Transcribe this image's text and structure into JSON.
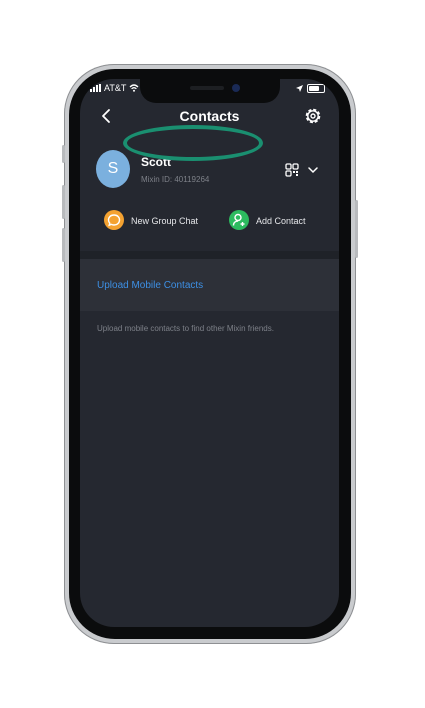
{
  "status_bar": {
    "carrier": "AT&T"
  },
  "nav": {
    "title": "Contacts",
    "back_icon": "chevron-left-icon",
    "settings_icon": "gear-icon"
  },
  "profile": {
    "avatar_initial": "S",
    "name": "Scott",
    "mixin_id": "Mixin ID: 40119264",
    "qr_icon": "qr-code-icon",
    "expand_icon": "chevron-down-icon"
  },
  "actions": {
    "new_group_chat": "New Group Chat",
    "add_contact": "Add Contact"
  },
  "upload": {
    "link": "Upload Mobile Contacts",
    "hint": "Upload mobile contacts to find other Mixin friends."
  },
  "colors": {
    "screen_bg": "#252830",
    "accent_link": "#3d8fe4",
    "group_icon": "#f4a231",
    "add_icon": "#2dbb5f",
    "highlight_ring": "#1a8f70"
  }
}
